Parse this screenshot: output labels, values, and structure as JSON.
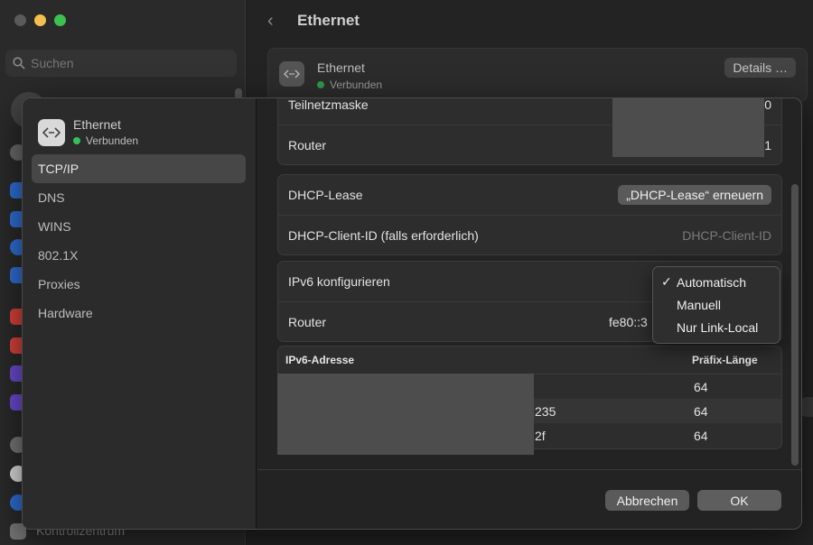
{
  "background": {
    "search_placeholder": "Suchen",
    "page_title": "Ethernet",
    "card": {
      "name": "Ethernet",
      "status": "Verbunden",
      "details_label": "Details …"
    },
    "bottom_label": "Kontrollzentrum"
  },
  "sheet": {
    "header": {
      "name": "Ethernet",
      "status": "Verbunden"
    },
    "sidebar": {
      "items": [
        {
          "label": "TCP/IP",
          "active": true
        },
        {
          "label": "DNS"
        },
        {
          "label": "WINS"
        },
        {
          "label": "802.1X"
        },
        {
          "label": "Proxies"
        },
        {
          "label": "Hardware"
        }
      ]
    },
    "ipv4": {
      "subnet_label": "Teilnetzmaske",
      "subnet_value_tail": "0",
      "router_label": "Router",
      "router_value_tail": "1"
    },
    "dhcp": {
      "lease_label": "DHCP-Lease",
      "renew_button": "„DHCP-Lease“ erneuern",
      "client_id_label": "DHCP-Client-ID (falls erforderlich)",
      "client_id_placeholder": "DHCP-Client-ID"
    },
    "ipv6": {
      "configure_label": "IPv6 konfigurieren",
      "router_label": "Router",
      "router_value": "fe80::3",
      "options": [
        {
          "label": "Automatisch",
          "checked": true
        },
        {
          "label": "Manuell"
        },
        {
          "label": "Nur Link-Local"
        }
      ]
    },
    "table": {
      "col_address": "IPv6-Adresse",
      "col_prefix": "Präfix-Länge",
      "rows": [
        {
          "address_tail": "",
          "prefix": "64"
        },
        {
          "address_tail": "235",
          "prefix": "64"
        },
        {
          "address_tail": "2f",
          "prefix": "64"
        }
      ]
    },
    "buttons": {
      "cancel": "Abbrechen",
      "ok": "OK"
    }
  }
}
